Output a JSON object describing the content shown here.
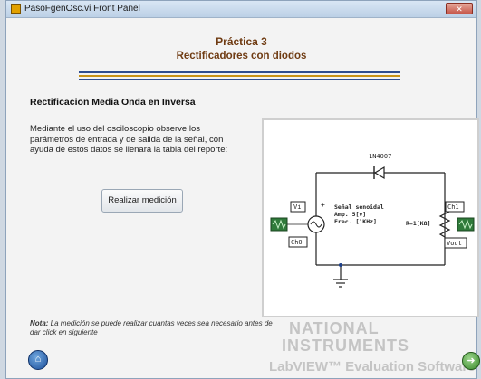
{
  "window": {
    "title": "PasoFgenOsc.vi Front Panel",
    "close_label": "✕"
  },
  "header": {
    "line1": "Práctica 3",
    "line2": "Rectificadores con diodos"
  },
  "section": {
    "title": "Rectificacion Media Onda en Inversa",
    "description": "Mediante el uso del osciloscopio observe los parámetros de entrada y de salida de la señal, con ayuda de estos datos se llenara la tabla del reporte:"
  },
  "measure_button": {
    "label": "Realizar medición"
  },
  "circuit": {
    "diode_label": "1N4007",
    "vi_label": "Vi",
    "ch0_label": "Ch0",
    "ch1_label": "Ch1",
    "vout_label": "Vout",
    "source_line1": "Señal senoidal",
    "source_line2": "Amp. 5[v]",
    "source_line3": "Frec. [1KHz]",
    "resistor_label": "R=1[KΩ]",
    "plus": "+",
    "minus": "−"
  },
  "note": {
    "bold": "Nota:",
    "text": " La medición se puede realizar cuantas veces sea necesario antes de dar click en siguiente"
  },
  "watermark": {
    "line1": "NATIONAL",
    "line2": "INSTRUMENTS",
    "line3": "LabVIEW™ Evaluation Software"
  },
  "nav": {
    "home_icon": "⌂",
    "next_icon": "➜"
  },
  "colors": {
    "header_text": "#6f3b12",
    "rule_blue": "#2e4d8f",
    "rule_gold": "#c79218"
  }
}
